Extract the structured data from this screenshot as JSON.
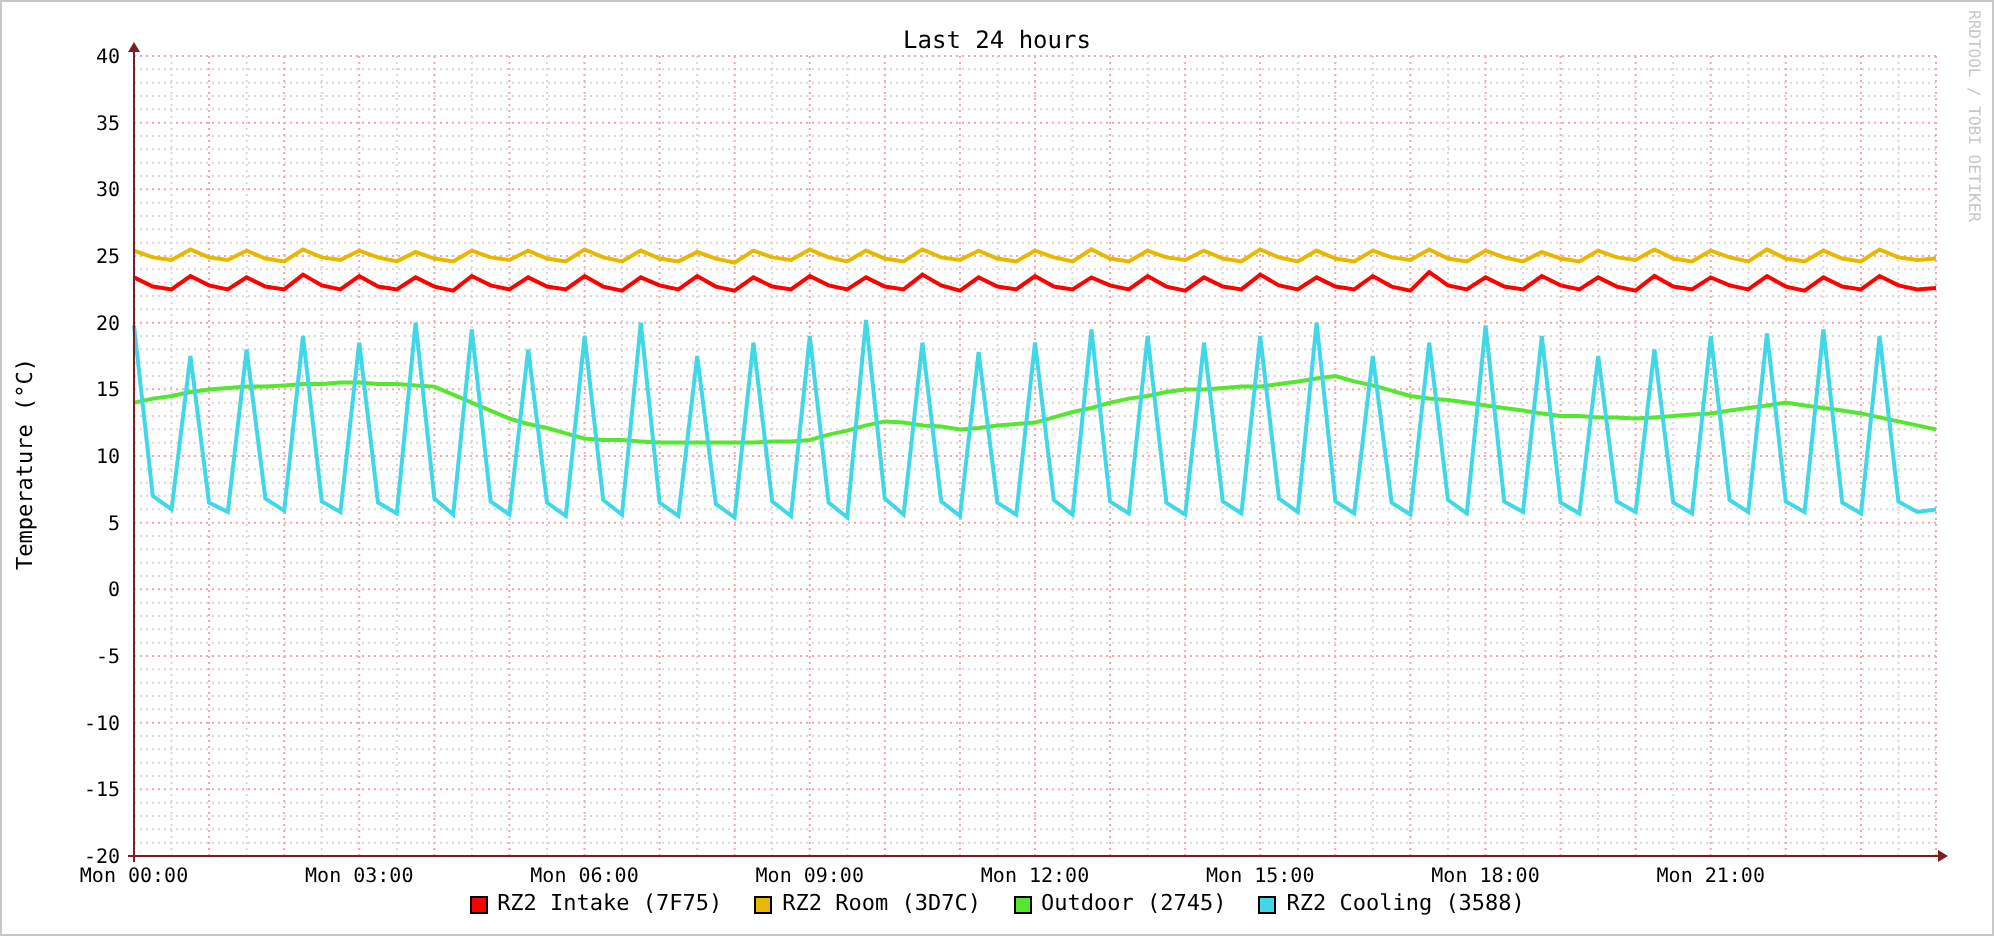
{
  "chart": {
    "credit": "RRDTOOL / TOBI OETIKER",
    "chart_data": {
      "type": "line",
      "grid": true,
      "title": "Last 24 hours",
      "ylabel": "Temperature (°C)",
      "ylim": [
        -20,
        40
      ],
      "categories": [
        "Mon 00:00",
        null,
        null,
        null,
        null,
        null,
        null,
        null,
        null,
        null,
        null,
        null,
        "Mon 03:00",
        null,
        null,
        null,
        null,
        null,
        null,
        null,
        null,
        null,
        null,
        null,
        "Mon 06:00",
        null,
        null,
        null,
        null,
        null,
        null,
        null,
        null,
        null,
        null,
        null,
        "Mon 09:00",
        null,
        null,
        null,
        null,
        null,
        null,
        null,
        null,
        null,
        null,
        null,
        "Mon 12:00",
        null,
        null,
        null,
        null,
        null,
        null,
        null,
        null,
        null,
        null,
        null,
        "Mon 15:00",
        null,
        null,
        null,
        null,
        null,
        null,
        null,
        null,
        null,
        null,
        null,
        "Mon 18:00",
        null,
        null,
        null,
        null,
        null,
        null,
        null,
        null,
        null,
        null,
        null,
        "Mon 21:00",
        null,
        null,
        null,
        null,
        null,
        null,
        null,
        null,
        null,
        null,
        null,
        null
      ],
      "yticks": [
        -20,
        -15,
        -10,
        -5,
        0,
        5,
        10,
        15,
        20,
        25,
        30,
        35,
        40
      ],
      "series": [
        {
          "name": "RZ2 Intake (7F75)",
          "color": "#ff0000",
          "values": [
            23.4,
            22.7,
            22.5,
            23.5,
            22.8,
            22.5,
            23.4,
            22.7,
            22.5,
            23.6,
            22.8,
            22.5,
            23.5,
            22.7,
            22.5,
            23.4,
            22.7,
            22.4,
            23.5,
            22.8,
            22.5,
            23.4,
            22.7,
            22.5,
            23.5,
            22.7,
            22.4,
            23.4,
            22.8,
            22.5,
            23.5,
            22.7,
            22.4,
            23.4,
            22.7,
            22.5,
            23.5,
            22.8,
            22.5,
            23.4,
            22.7,
            22.5,
            23.6,
            22.8,
            22.4,
            23.4,
            22.7,
            22.5,
            23.5,
            22.7,
            22.5,
            23.4,
            22.8,
            22.5,
            23.5,
            22.7,
            22.4,
            23.4,
            22.7,
            22.5,
            23.6,
            22.8,
            22.5,
            23.4,
            22.7,
            22.5,
            23.5,
            22.7,
            22.4,
            23.8,
            22.8,
            22.5,
            23.4,
            22.7,
            22.5,
            23.5,
            22.8,
            22.5,
            23.4,
            22.7,
            22.4,
            23.5,
            22.7,
            22.5,
            23.4,
            22.8,
            22.5,
            23.5,
            22.7,
            22.4,
            23.4,
            22.7,
            22.5,
            23.5,
            22.8,
            22.5,
            22.6
          ]
        },
        {
          "name": "RZ2 Room (3D7C)",
          "color": "#e8b800",
          "values": [
            25.4,
            24.9,
            24.7,
            25.5,
            24.9,
            24.7,
            25.4,
            24.8,
            24.6,
            25.5,
            24.9,
            24.7,
            25.4,
            24.9,
            24.6,
            25.3,
            24.8,
            24.6,
            25.4,
            24.9,
            24.7,
            25.4,
            24.8,
            24.6,
            25.5,
            24.9,
            24.6,
            25.4,
            24.8,
            24.6,
            25.3,
            24.8,
            24.5,
            25.4,
            24.9,
            24.7,
            25.5,
            24.9,
            24.6,
            25.4,
            24.8,
            24.6,
            25.5,
            24.9,
            24.7,
            25.4,
            24.8,
            24.6,
            25.4,
            24.9,
            24.6,
            25.5,
            24.8,
            24.6,
            25.4,
            24.9,
            24.7,
            25.4,
            24.8,
            24.6,
            25.5,
            24.9,
            24.6,
            25.4,
            24.8,
            24.6,
            25.4,
            24.9,
            24.7,
            25.5,
            24.8,
            24.6,
            25.4,
            24.9,
            24.6,
            25.3,
            24.8,
            24.6,
            25.4,
            24.9,
            24.7,
            25.5,
            24.8,
            24.6,
            25.4,
            24.9,
            24.6,
            25.5,
            24.8,
            24.6,
            25.4,
            24.8,
            24.6,
            25.5,
            24.9,
            24.7,
            24.8
          ]
        },
        {
          "name": "Outdoor (2745)",
          "color": "#55e630",
          "values": [
            14,
            14.3,
            14.5,
            14.8,
            15,
            15.1,
            15.2,
            15.2,
            15.3,
            15.4,
            15.4,
            15.5,
            15.5,
            15.4,
            15.4,
            15.3,
            15.2,
            14.6,
            14,
            13.4,
            12.8,
            12.4,
            12.1,
            11.7,
            11.3,
            11.2,
            11.2,
            11.1,
            11,
            11,
            11,
            11,
            11,
            11,
            11.1,
            11.1,
            11.2,
            11.6,
            11.9,
            12.3,
            12.6,
            12.5,
            12.3,
            12.2,
            12,
            12.1,
            12.3,
            12.4,
            12.5,
            12.9,
            13.3,
            13.6,
            14,
            14.3,
            14.5,
            14.8,
            15,
            15,
            15.1,
            15.2,
            15.2,
            15.4,
            15.6,
            15.8,
            16,
            15.6,
            15.3,
            14.9,
            14.5,
            14.3,
            14.2,
            14,
            13.8,
            13.6,
            13.4,
            13.2,
            13,
            13,
            12.9,
            12.9,
            12.8,
            12.9,
            13,
            13.1,
            13.2,
            13.4,
            13.6,
            13.8,
            14,
            13.8,
            13.6,
            13.4,
            13.2,
            12.9,
            12.6,
            12.3,
            12
          ]
        },
        {
          "name": "RZ2 Cooling (3588)",
          "color": "#40d8e8",
          "values": [
            19.8,
            7,
            6,
            17.5,
            6.5,
            5.8,
            18,
            6.8,
            5.9,
            19,
            6.6,
            5.8,
            18.5,
            6.5,
            5.7,
            20,
            6.8,
            5.6,
            19.5,
            6.6,
            5.6,
            18,
            6.5,
            5.5,
            19,
            6.7,
            5.6,
            20,
            6.5,
            5.5,
            17.5,
            6.4,
            5.4,
            18.5,
            6.6,
            5.5,
            19,
            6.5,
            5.4,
            20.2,
            6.8,
            5.6,
            18.5,
            6.6,
            5.5,
            17.8,
            6.5,
            5.6,
            18.5,
            6.7,
            5.6,
            19.5,
            6.6,
            5.7,
            19,
            6.5,
            5.6,
            18.5,
            6.6,
            5.7,
            19,
            6.8,
            5.8,
            20,
            6.6,
            5.7,
            17.5,
            6.5,
            5.6,
            18.5,
            6.7,
            5.7,
            19.8,
            6.6,
            5.8,
            19,
            6.5,
            5.7,
            17.5,
            6.6,
            5.8,
            18,
            6.5,
            5.7,
            19,
            6.7,
            5.8,
            19.2,
            6.6,
            5.8,
            19.5,
            6.5,
            5.7,
            19,
            6.6,
            5.8,
            6
          ]
        }
      ]
    }
  }
}
